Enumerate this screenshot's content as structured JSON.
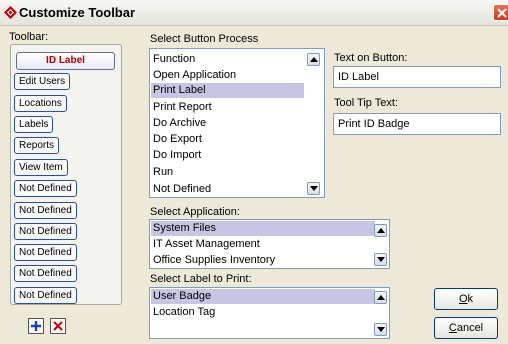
{
  "window": {
    "title": "Customize Toolbar"
  },
  "toolbar": {
    "label": "Toolbar:",
    "buttons": [
      "ID Label",
      "Edit Users",
      "Locations",
      "Labels",
      "Reports",
      "View Item",
      "Not Defined",
      "Not Defined",
      "Not Defined",
      "Not Defined",
      "Not Defined",
      "Not Defined"
    ],
    "selected_index": 0
  },
  "process": {
    "label": "Select Button Process",
    "items": [
      "Function",
      "Open Application",
      "Print Label",
      "Print Report",
      "Do Archive",
      "Do Export",
      "Do Import",
      "Run",
      "Not Defined"
    ],
    "selected": "Print Label"
  },
  "text_on_button": {
    "label": "Text on Button:",
    "value": "ID Label"
  },
  "tooltip": {
    "label": "Tool Tip Text:",
    "value": "Print ID Badge"
  },
  "application": {
    "label": "Select Application:",
    "items": [
      "System Files",
      "IT Asset Management",
      "Office Supplies Inventory"
    ],
    "selected": "System Files"
  },
  "label_to_print": {
    "label": "Select Label to Print:",
    "items": [
      "User Badge",
      "Location Tag"
    ],
    "selected": "User Badge"
  },
  "ok_button": {
    "label_mnemonic": "O",
    "label_rest": "k"
  },
  "cancel_button": {
    "label_mnemonic": "C",
    "label_rest": "ancel"
  },
  "icons": {
    "add": "plus-icon",
    "delete": "x-icon",
    "app": "diamond-icon",
    "close": "close-icon"
  },
  "colors": {
    "accent": "#c00000",
    "selection": "#c6c6e4",
    "border": "#7f9db9",
    "add_icon": "#1a3fb8",
    "delete_icon": "#c00000"
  }
}
